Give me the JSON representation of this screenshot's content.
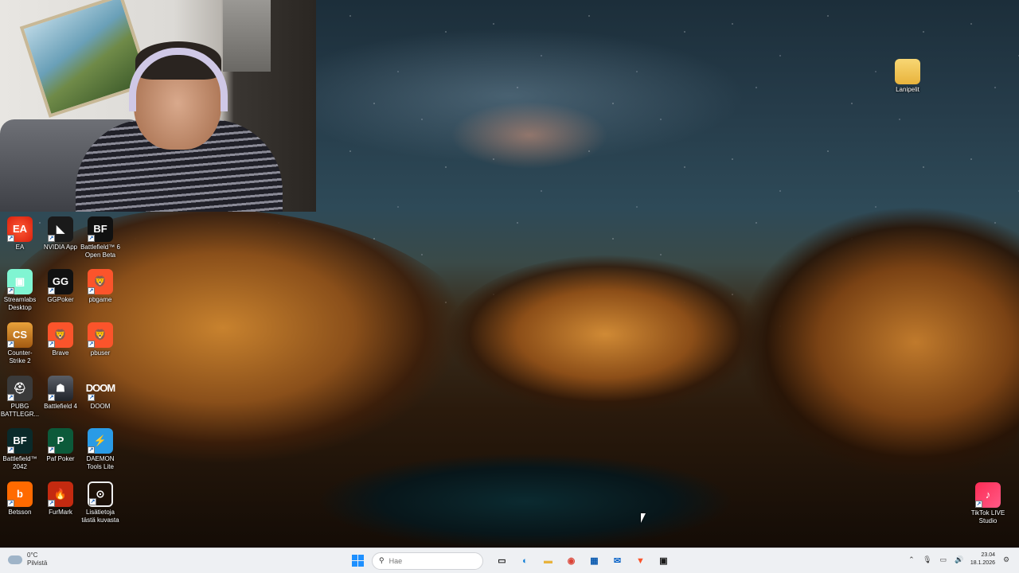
{
  "desktop": {
    "icons_left": [
      {
        "label": "EA",
        "glyph": "EA",
        "icon": "ea-icon",
        "cls": "i-ea"
      },
      {
        "label": "NVIDIA App",
        "glyph": "◣",
        "icon": "nvidia-icon",
        "cls": "i-nvidia"
      },
      {
        "label": "Battlefield™ 6 Open Beta",
        "glyph": "BF",
        "icon": "battlefield6-icon",
        "cls": "i-bf6"
      },
      {
        "label": "Streamlabs Desktop",
        "glyph": "▣",
        "icon": "streamlabs-icon",
        "cls": "i-streamlabs"
      },
      {
        "label": "GGPoker",
        "glyph": "GG",
        "icon": "ggpoker-icon",
        "cls": "i-gg"
      },
      {
        "label": "pbgame",
        "glyph": "🦁",
        "icon": "brave-icon",
        "cls": "i-brave"
      },
      {
        "label": "Counter-Strike 2",
        "glyph": "CS",
        "icon": "counter-strike-icon",
        "cls": "i-cs"
      },
      {
        "label": "Brave",
        "glyph": "🦁",
        "icon": "brave-icon",
        "cls": "i-brave"
      },
      {
        "label": "pbuser",
        "glyph": "🦁",
        "icon": "brave-icon",
        "cls": "i-brave"
      },
      {
        "label": "PUBG BATTLEGR...",
        "glyph": "⛑",
        "icon": "pubg-icon",
        "cls": "i-pubg"
      },
      {
        "label": "Battlefield 4",
        "glyph": "☗",
        "icon": "battlefield4-icon",
        "cls": "i-bf4"
      },
      {
        "label": "DOOM",
        "glyph": "DOOM",
        "icon": "doom-icon",
        "cls": "i-doom"
      },
      {
        "label": "Battlefield™ 2042",
        "glyph": "BF",
        "icon": "battlefield2042-icon",
        "cls": "i-bf2042"
      },
      {
        "label": "Paf Poker",
        "glyph": "P",
        "icon": "paf-poker-icon",
        "cls": "i-paf"
      },
      {
        "label": "DAEMON Tools Lite",
        "glyph": "⚡",
        "icon": "daemon-tools-icon",
        "cls": "i-daemon"
      },
      {
        "label": "Betsson",
        "glyph": "b",
        "icon": "betsson-icon",
        "cls": "i-betsson"
      },
      {
        "label": "FurMark",
        "glyph": "🔥",
        "icon": "furmark-icon",
        "cls": "i-furmark"
      },
      {
        "label": "Lisätietoja tästä kuvasta",
        "glyph": "⊙",
        "icon": "info-camera-icon",
        "cls": "i-info"
      }
    ],
    "folder": {
      "label": "Lanipelit"
    },
    "tiktok": {
      "label": "TikTok LIVE Studio"
    }
  },
  "taskbar": {
    "weather_temp": "0°C",
    "weather_desc": "Pilvistä",
    "search_placeholder": "Hae",
    "time": "23.04",
    "date": "18.1.2026",
    "pinned": [
      {
        "name": "task-view-icon",
        "glyph": "▭",
        "color": "#222222"
      },
      {
        "name": "edge-icon",
        "glyph": "◐",
        "color": "#0c7cd5"
      },
      {
        "name": "file-explorer-icon",
        "glyph": "▬",
        "color": "#e8b33c"
      },
      {
        "name": "chrome-icon",
        "glyph": "◉",
        "color": "#db4437"
      },
      {
        "name": "microsoft-store-icon",
        "glyph": "▦",
        "color": "#0a5ab0"
      },
      {
        "name": "outlook-icon",
        "glyph": "✉",
        "color": "#0a64c8"
      },
      {
        "name": "brave-taskbar-icon",
        "glyph": "▼",
        "color": "#fb542b"
      },
      {
        "name": "streamlabs-taskbar-icon",
        "glyph": "▣",
        "color": "#1a1a1a"
      }
    ],
    "tray": [
      {
        "name": "chevron-up-icon",
        "glyph": "⌃"
      },
      {
        "name": "microphone-icon",
        "glyph": "🎙"
      },
      {
        "name": "display-icon",
        "glyph": "▭"
      },
      {
        "name": "speaker-icon",
        "glyph": "🔊"
      }
    ]
  }
}
